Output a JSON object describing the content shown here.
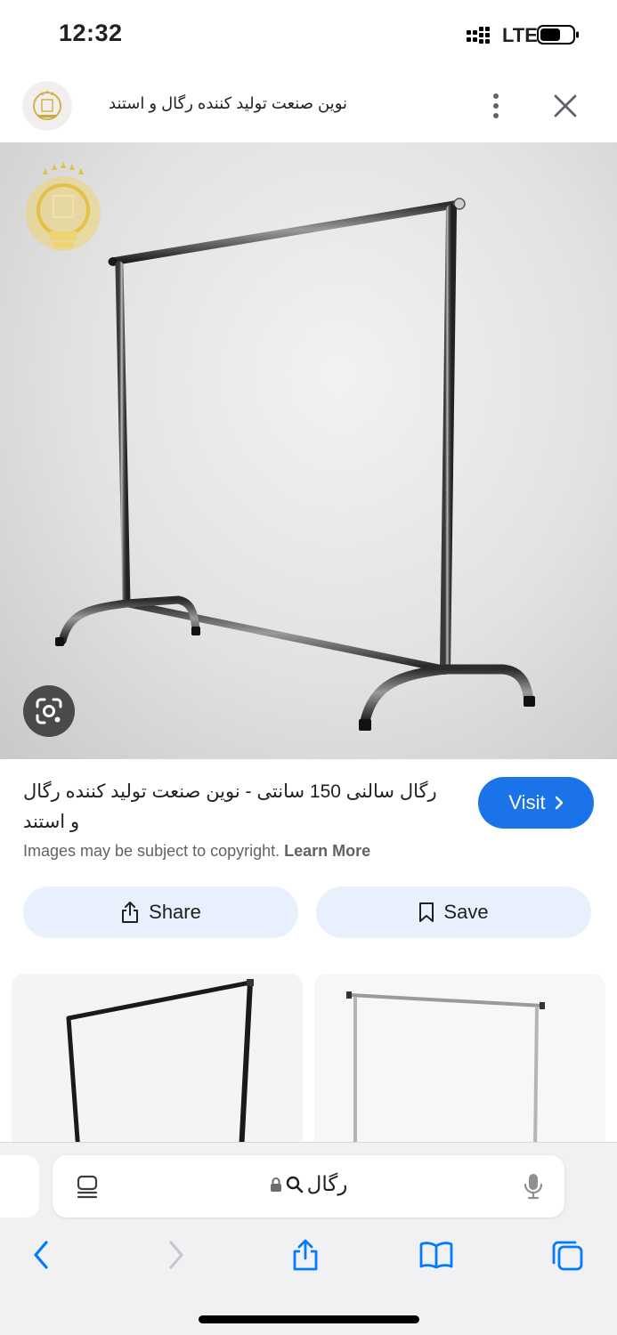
{
  "status_bar": {
    "time": "12:32",
    "network": "LTE"
  },
  "header": {
    "site_title": "نوین صنعت تولید کننده رگال و استند",
    "logo_icon": "site-logo-icon",
    "more_icon": "more-vertical-icon",
    "close_icon": "close-icon"
  },
  "main_image": {
    "lens_icon": "lens-icon"
  },
  "result": {
    "title": "رگال سالنی 150 سانتی - نوین صنعت تولید کننده رگال و استند",
    "visit_label": "Visit",
    "copyright_text": "Images may be subject to copyright.",
    "learn_more_label": "Learn More"
  },
  "actions": {
    "share_label": "Share",
    "save_label": "Save"
  },
  "address_bar": {
    "value": "رگال"
  },
  "colors": {
    "accent": "#1a73e8",
    "pill_bg": "#e8f0fe",
    "toolbar_bg": "#f1f1f3",
    "ios_blue": "#007aff"
  }
}
